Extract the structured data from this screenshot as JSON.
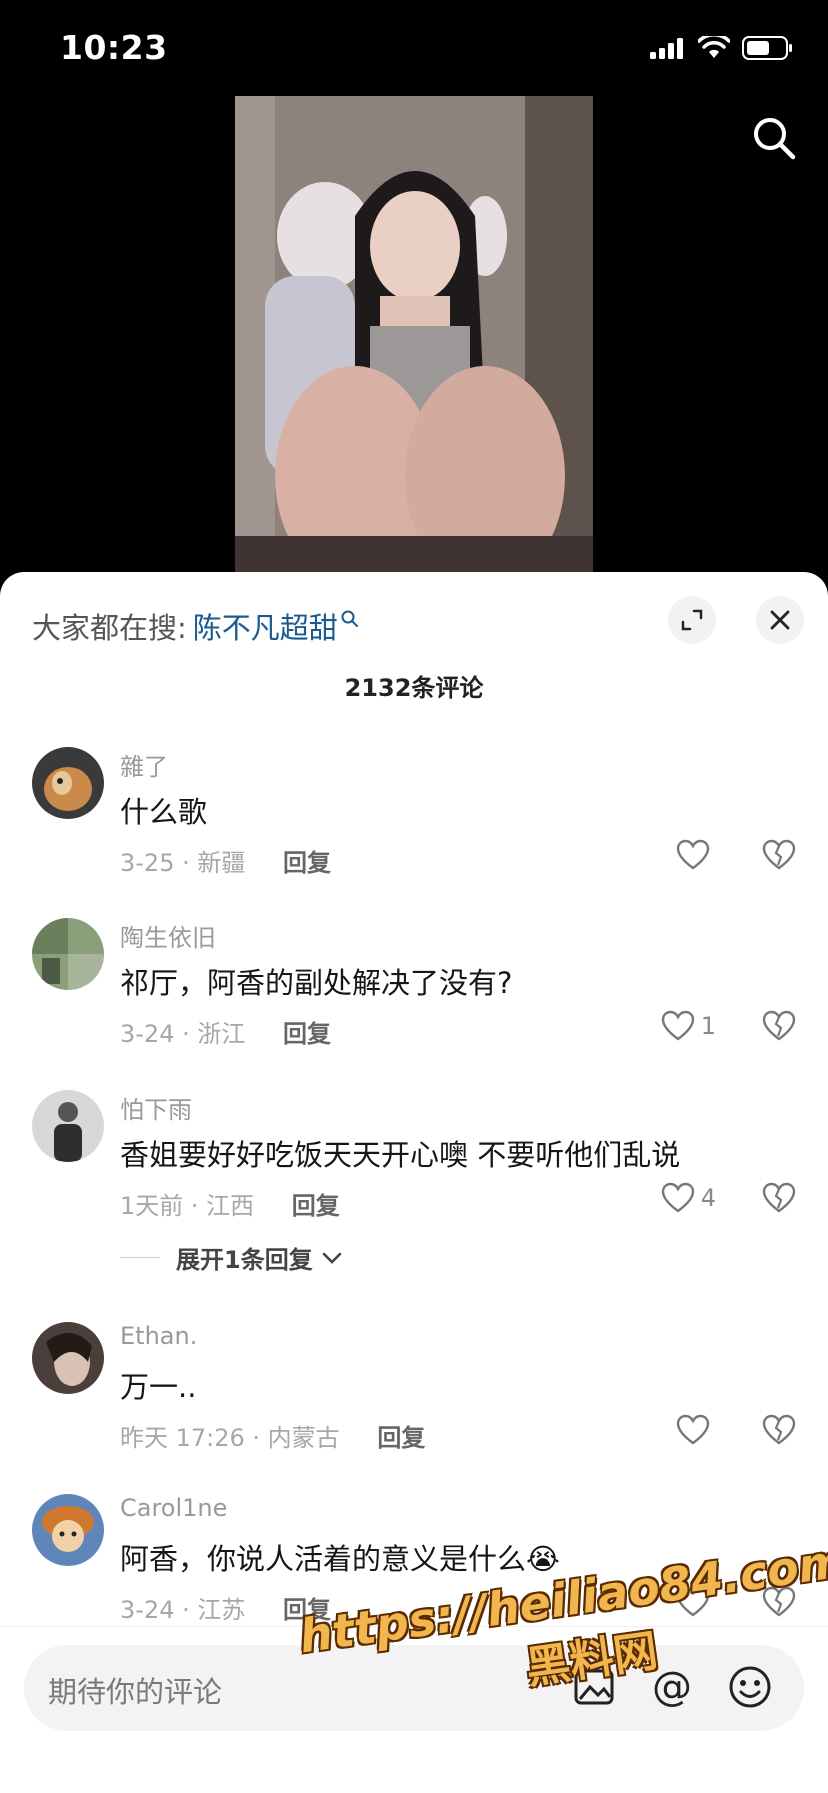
{
  "status_bar": {
    "time": "10:23"
  },
  "trending": {
    "prefix": "大家都在搜:",
    "term": "陈不凡超甜"
  },
  "comments_header": {
    "count": "2132条评论"
  },
  "comments": [
    {
      "user": "雜了",
      "text": "什么歌",
      "date_loc": "3-25 · 新疆",
      "reply": "回复",
      "likes": ""
    },
    {
      "user": "陶生依旧",
      "text": "祁厅，阿香的副处解决了没有?",
      "date_loc": "3-24 · 浙江",
      "reply": "回复",
      "likes": "1"
    },
    {
      "user": "怕下雨",
      "text": "香姐要好好吃饭天天开心噢 不要听他们乱说",
      "date_loc": "1天前 · 江西",
      "reply": "回复",
      "likes": "4",
      "expand": "展开1条回复"
    },
    {
      "user": "Ethan.",
      "text": "万一..",
      "date_loc": "昨天 17:26 · 内蒙古",
      "reply": "回复",
      "likes": ""
    },
    {
      "user": "Carol1ne",
      "text": "阿香，你说人活着的意义是什么😭",
      "date_loc": "3-24 · 江苏",
      "reply": "回复",
      "likes": ""
    }
  ],
  "input": {
    "placeholder": "期待你的评论",
    "at": "@"
  },
  "watermark": {
    "url": "https://heiliao84.com",
    "name": "黑料网"
  },
  "colors": {
    "trend_term": "#1d5a92",
    "sheet_bg": "#ffffff",
    "watermark": "#f2b64f"
  }
}
